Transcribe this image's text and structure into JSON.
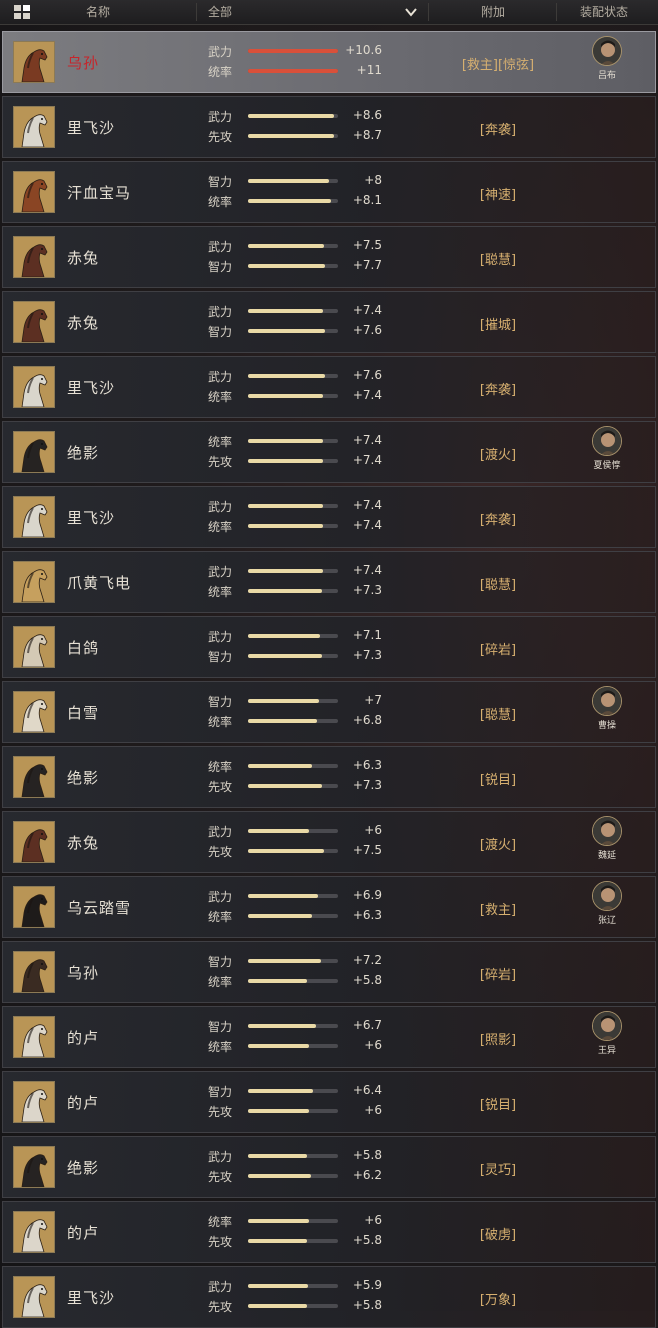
{
  "header": {
    "name_col": "名称",
    "filter_value": "全部",
    "extra_col": "附加",
    "equip_col": "装配状态"
  },
  "colors": {
    "selected_bar": "#d9503a",
    "bar": "#e9d9a6",
    "skill": "#d7b070",
    "selected_name": "#c8242a"
  },
  "rows": [
    {
      "name": "乌孙",
      "stats": [
        {
          "label": "武力",
          "value": "+10.6",
          "level": 1.0
        },
        {
          "label": "统率",
          "value": "+11",
          "level": 1.0
        }
      ],
      "skill": "[救主][惊弦]",
      "equipped": "吕布",
      "selected": true,
      "coat": "#7a3a22",
      "icon": "horse-icon"
    },
    {
      "name": "里飞沙",
      "stats": [
        {
          "label": "武力",
          "value": "+8.6",
          "level": 0.95
        },
        {
          "label": "先攻",
          "value": "+8.7",
          "level": 0.95
        }
      ],
      "skill": "[奔袭]",
      "equipped": "",
      "coat": "#d9d6cc",
      "icon": "horse-icon"
    },
    {
      "name": "汗血宝马",
      "stats": [
        {
          "label": "智力",
          "value": "+8",
          "level": 0.9
        },
        {
          "label": "统率",
          "value": "+8.1",
          "level": 0.92
        }
      ],
      "skill": "[神速]",
      "equipped": "",
      "coat": "#8a4524",
      "icon": "horse-icon"
    },
    {
      "name": "赤兔",
      "stats": [
        {
          "label": "武力",
          "value": "+7.5",
          "level": 0.84
        },
        {
          "label": "智力",
          "value": "+7.7",
          "level": 0.86
        }
      ],
      "skill": "[聪慧]",
      "equipped": "",
      "coat": "#5c2f22",
      "icon": "horse-icon"
    },
    {
      "name": "赤兔",
      "stats": [
        {
          "label": "武力",
          "value": "+7.4",
          "level": 0.83
        },
        {
          "label": "智力",
          "value": "+7.6",
          "level": 0.85
        }
      ],
      "skill": "[摧城]",
      "equipped": "",
      "coat": "#5c2f22",
      "icon": "horse-icon"
    },
    {
      "name": "里飞沙",
      "stats": [
        {
          "label": "武力",
          "value": "+7.6",
          "level": 0.85
        },
        {
          "label": "统率",
          "value": "+7.4",
          "level": 0.83
        }
      ],
      "skill": "[奔袭]",
      "equipped": "",
      "coat": "#d9d6cc",
      "icon": "horse-icon"
    },
    {
      "name": "绝影",
      "stats": [
        {
          "label": "统率",
          "value": "+7.4",
          "level": 0.83
        },
        {
          "label": "先攻",
          "value": "+7.4",
          "level": 0.83
        }
      ],
      "skill": "[渡火]",
      "equipped": "夏侯惇",
      "coat": "#262322",
      "icon": "horse-icon"
    },
    {
      "name": "里飞沙",
      "stats": [
        {
          "label": "武力",
          "value": "+7.4",
          "level": 0.83
        },
        {
          "label": "统率",
          "value": "+7.4",
          "level": 0.83
        }
      ],
      "skill": "[奔袭]",
      "equipped": "",
      "coat": "#d9d6cc",
      "icon": "horse-icon"
    },
    {
      "name": "爪黄飞电",
      "stats": [
        {
          "label": "武力",
          "value": "+7.4",
          "level": 0.83
        },
        {
          "label": "统率",
          "value": "+7.3",
          "level": 0.82
        }
      ],
      "skill": "[聪慧]",
      "equipped": "",
      "coat": "#c6a05e",
      "icon": "horse-icon"
    },
    {
      "name": "白鸽",
      "stats": [
        {
          "label": "武力",
          "value": "+7.1",
          "level": 0.8
        },
        {
          "label": "智力",
          "value": "+7.3",
          "level": 0.82
        }
      ],
      "skill": "[碎岩]",
      "equipped": "",
      "coat": "#d4c9b5",
      "icon": "horse-icon"
    },
    {
      "name": "白雪",
      "stats": [
        {
          "label": "智力",
          "value": "+7",
          "level": 0.79
        },
        {
          "label": "统率",
          "value": "+6.8",
          "level": 0.77
        }
      ],
      "skill": "[聪慧]",
      "equipped": "曹操",
      "coat": "#e0d8c8",
      "icon": "horse-icon"
    },
    {
      "name": "绝影",
      "stats": [
        {
          "label": "统率",
          "value": "+6.3",
          "level": 0.71
        },
        {
          "label": "先攻",
          "value": "+7.3",
          "level": 0.82
        }
      ],
      "skill": "[锐目]",
      "equipped": "",
      "coat": "#262322",
      "icon": "horse-icon"
    },
    {
      "name": "赤兔",
      "stats": [
        {
          "label": "武力",
          "value": "+6",
          "level": 0.68
        },
        {
          "label": "先攻",
          "value": "+7.5",
          "level": 0.84
        }
      ],
      "skill": "[渡火]",
      "equipped": "魏延",
      "coat": "#5c2f22",
      "icon": "horse-icon"
    },
    {
      "name": "乌云踏雪",
      "stats": [
        {
          "label": "武力",
          "value": "+6.9",
          "level": 0.78
        },
        {
          "label": "统率",
          "value": "+6.3",
          "level": 0.71
        }
      ],
      "skill": "[救主]",
      "equipped": "张辽",
      "coat": "#1e1b1a",
      "icon": "horse-icon"
    },
    {
      "name": "乌孙",
      "stats": [
        {
          "label": "智力",
          "value": "+7.2",
          "level": 0.81
        },
        {
          "label": "统率",
          "value": "+5.8",
          "level": 0.66
        }
      ],
      "skill": "[碎岩]",
      "equipped": "",
      "coat": "#3a2b22",
      "icon": "horse-icon"
    },
    {
      "name": "的卢",
      "stats": [
        {
          "label": "智力",
          "value": "+6.7",
          "level": 0.76
        },
        {
          "label": "统率",
          "value": "+6",
          "level": 0.68
        }
      ],
      "skill": "[照影]",
      "equipped": "王异",
      "coat": "#dcd6ca",
      "icon": "horse-icon"
    },
    {
      "name": "的卢",
      "stats": [
        {
          "label": "智力",
          "value": "+6.4",
          "level": 0.72
        },
        {
          "label": "先攻",
          "value": "+6",
          "level": 0.68
        }
      ],
      "skill": "[锐目]",
      "equipped": "",
      "coat": "#dcd6ca",
      "icon": "horse-icon"
    },
    {
      "name": "绝影",
      "stats": [
        {
          "label": "武力",
          "value": "+5.8",
          "level": 0.66
        },
        {
          "label": "先攻",
          "value": "+6.2",
          "level": 0.7
        }
      ],
      "skill": "[灵巧]",
      "equipped": "",
      "coat": "#262322",
      "icon": "horse-icon"
    },
    {
      "name": "的卢",
      "stats": [
        {
          "label": "统率",
          "value": "+6",
          "level": 0.68
        },
        {
          "label": "先攻",
          "value": "+5.8",
          "level": 0.66
        }
      ],
      "skill": "[破虏]",
      "equipped": "",
      "coat": "#dcd6ca",
      "icon": "horse-icon"
    },
    {
      "name": "里飞沙",
      "stats": [
        {
          "label": "武力",
          "value": "+5.9",
          "level": 0.67
        },
        {
          "label": "先攻",
          "value": "+5.8",
          "level": 0.66
        }
      ],
      "skill": "[万象]",
      "equipped": "",
      "coat": "#d9d6cc",
      "icon": "horse-icon"
    }
  ]
}
